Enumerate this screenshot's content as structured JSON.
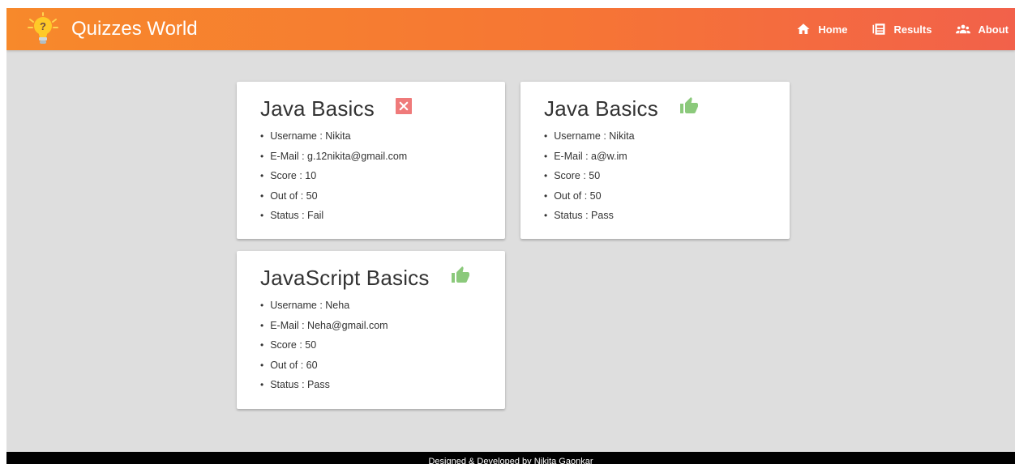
{
  "navbar": {
    "brand_title": "Quizzes World",
    "brand_icon": "lightbulb-question-icon",
    "links": [
      {
        "label": "Home",
        "icon": "home-icon"
      },
      {
        "label": "Results",
        "icon": "newspaper-icon"
      },
      {
        "label": "About",
        "icon": "people-icon"
      }
    ]
  },
  "results": [
    {
      "title": "Java Basics",
      "status_icon": "fail-x-icon",
      "username_label": "Username : Nikita",
      "email_label": "E-Mail : g.12nikita@gmail.com",
      "score_label": "Score : 10",
      "out_of_label": "Out of : 50",
      "status_label": "Status : Fail"
    },
    {
      "title": "Java Basics",
      "status_icon": "thumbs-up-icon",
      "username_label": "Username : Nikita",
      "email_label": "E-Mail : a@w.im",
      "score_label": "Score : 50",
      "out_of_label": "Out of : 50",
      "status_label": "Status : Pass"
    },
    {
      "title": "JavaScript Basics",
      "status_icon": "thumbs-up-icon",
      "username_label": "Username : Neha",
      "email_label": "E-Mail : Neha@gmail.com",
      "score_label": "Score : 50",
      "out_of_label": "Out of : 60",
      "status_label": "Status : Pass"
    }
  ],
  "footer": {
    "text": "Designed & Developed by Nikita Gaonkar"
  },
  "colors": {
    "navbar_start": "#f7892b",
    "navbar_end": "#f2614a",
    "fail": "#ef7a7a",
    "pass": "#8bc97b",
    "background": "#dedede"
  }
}
